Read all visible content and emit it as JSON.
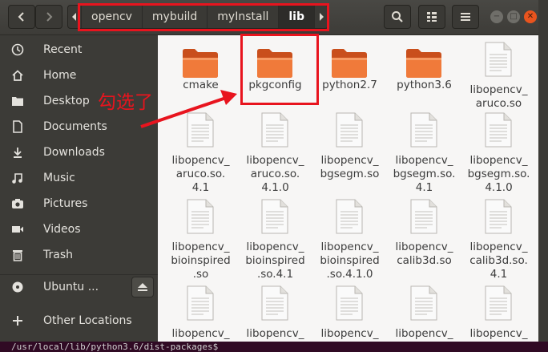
{
  "header": {
    "breadcrumbs": [
      {
        "label": "opencv"
      },
      {
        "label": "mybuild"
      },
      {
        "label": "myInstall"
      },
      {
        "label": "lib"
      }
    ]
  },
  "sidebar": {
    "items": [
      {
        "label": "Recent",
        "icon": "clock-icon"
      },
      {
        "label": "Home",
        "icon": "home-icon"
      },
      {
        "label": "Desktop",
        "icon": "folder-icon"
      },
      {
        "label": "Documents",
        "icon": "document-icon"
      },
      {
        "label": "Downloads",
        "icon": "download-icon"
      },
      {
        "label": "Music",
        "icon": "music-icon"
      },
      {
        "label": "Pictures",
        "icon": "camera-icon"
      },
      {
        "label": "Videos",
        "icon": "video-icon"
      },
      {
        "label": "Trash",
        "icon": "trash-icon"
      },
      {
        "label": "Ubuntu ...",
        "icon": "disc-icon"
      },
      {
        "label": "Other Locations",
        "icon": "plus-icon"
      }
    ]
  },
  "files": [
    {
      "name": "cmake",
      "type": "folder"
    },
    {
      "name": "pkgconfig",
      "type": "folder"
    },
    {
      "name": "python2.7",
      "type": "folder"
    },
    {
      "name": "python3.6",
      "type": "folder"
    },
    {
      "name": "libopencv_\naruco.so",
      "type": "file"
    },
    {
      "name": "libopencv_\naruco.so.\n4.1",
      "type": "file"
    },
    {
      "name": "libopencv_\naruco.so.\n4.1.0",
      "type": "file"
    },
    {
      "name": "libopencv_\nbgsegm.so",
      "type": "file"
    },
    {
      "name": "libopencv_\nbgsegm.so.\n4.1",
      "type": "file"
    },
    {
      "name": "libopencv_\nbgsegm.so.\n4.1.0",
      "type": "file"
    },
    {
      "name": "libopencv_\nbioinspired\n.so",
      "type": "file"
    },
    {
      "name": "libopencv_\nbioinspired\n.so.4.1",
      "type": "file"
    },
    {
      "name": "libopencv_\nbioinspired\n.so.4.1.0",
      "type": "file"
    },
    {
      "name": "libopencv_\ncalib3d.so",
      "type": "file"
    },
    {
      "name": "libopencv_\ncalib3d.so.\n4.1",
      "type": "file"
    },
    {
      "name": "libopencv_",
      "type": "file"
    },
    {
      "name": "libopencv_",
      "type": "file"
    },
    {
      "name": "libopencv_",
      "type": "file"
    },
    {
      "name": "libopencv_",
      "type": "file"
    },
    {
      "name": "libopencv_",
      "type": "file"
    }
  ],
  "annotation": {
    "text": "勾选了"
  },
  "terminal": {
    "text": "/usr/local/lib/python3.6/dist-packages$"
  },
  "colors": {
    "accent": "#e8141e",
    "folder": "#f07a3a",
    "header": "#3d3c38",
    "sidebar": "#3c3b37"
  }
}
